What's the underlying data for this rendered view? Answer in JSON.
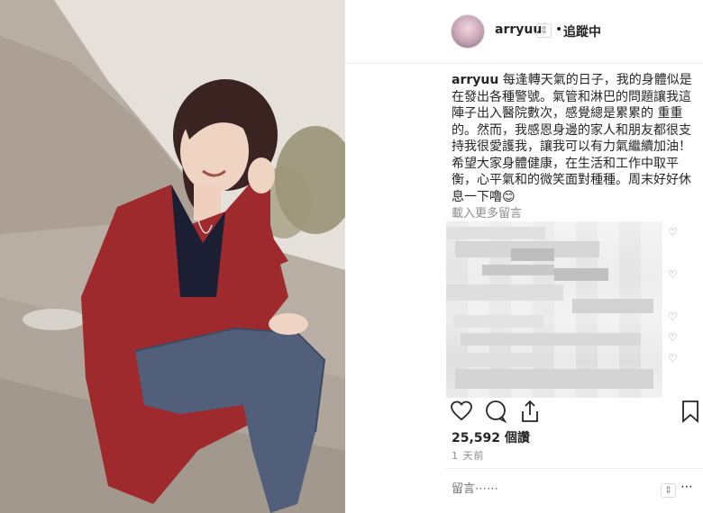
{
  "header": {
    "username": "arryuu",
    "sort_symbol": "⇕",
    "separator": "•",
    "follow_label": "追蹤中"
  },
  "caption": {
    "username": "arryuu",
    "text": "每逢轉天氣的日子，我的身體似是在發出各種警號。氣管和淋巴的問題讓我這陣子出入醫院數次，感覺總是累累的 重重的。然而，我感恩身邊的家人和朋友都很支持我很愛護我，讓我可以有力氣繼續加油！希望大家身體健康，在生活和工作中取平衡，心平氣和的微笑面對種種。周末好好休息一下嚕😊"
  },
  "comments": {
    "load_more_label": "載入更多留言"
  },
  "actions": {
    "like_icon": "heart-outline-icon",
    "comment_icon": "comment-bubble-icon",
    "share_icon": "share-icon",
    "save_icon": "bookmark-icon"
  },
  "stats": {
    "likes_count": "25,592",
    "likes_label": "個讚",
    "time_ago": "1 天前"
  },
  "add_comment": {
    "placeholder": "留言⋯⋯",
    "sort_symbol": "⇕",
    "more_symbol": "⋯"
  }
}
